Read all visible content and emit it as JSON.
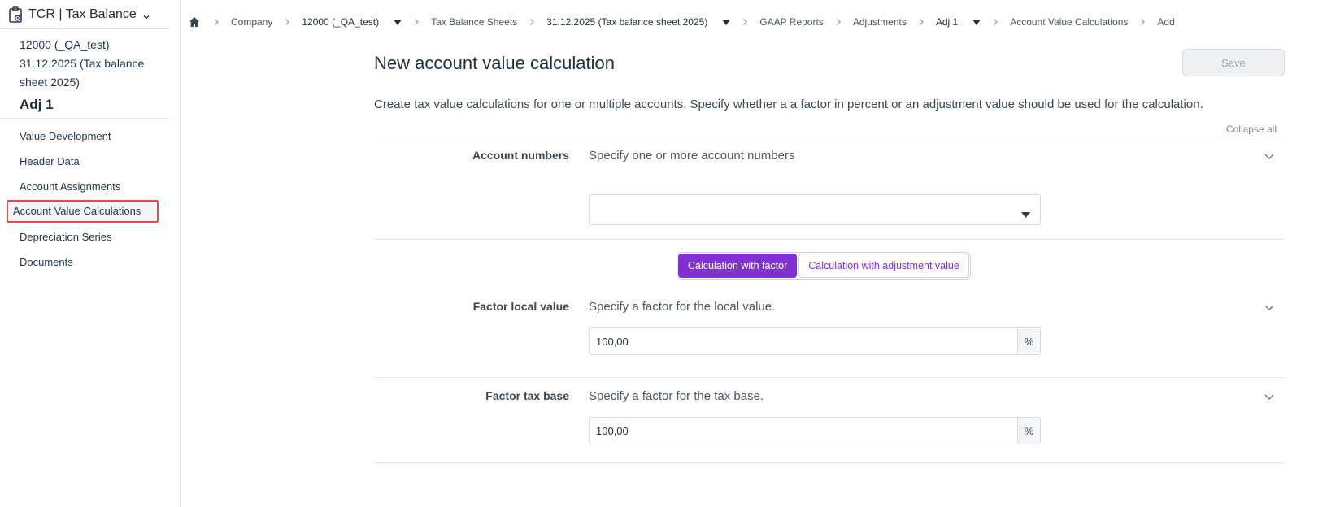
{
  "app": {
    "title": "TCR | Tax Balance"
  },
  "context": {
    "company": "12000 (_QA_test)",
    "balance_sheet": "31.12.2025 (Tax balance sheet 2025)",
    "current": "Adj 1"
  },
  "nav": {
    "items": [
      {
        "label": "Value Development"
      },
      {
        "label": "Header Data"
      },
      {
        "label": "Account Assignments"
      },
      {
        "label": "Account Value Calculations"
      },
      {
        "label": "Depreciation Series"
      },
      {
        "label": "Documents"
      }
    ],
    "active_index": 3
  },
  "breadcrumb": {
    "items": [
      "Company",
      "12000 (_QA_test)",
      "Tax Balance Sheets",
      "31.12.2025 (Tax balance sheet 2025)",
      "GAAP Reports",
      "Adjustments",
      "Adj 1",
      "Account Value Calculations",
      "Add"
    ]
  },
  "page": {
    "title": "New account value calculation",
    "save_label": "Save",
    "description": "Create tax value calculations for one or multiple accounts. Specify whether a a factor in percent or an adjustment value should be used for the calculation.",
    "collapse_all": "Collapse all"
  },
  "account_numbers": {
    "label": "Account numbers",
    "description": "Specify one or more account numbers",
    "value": ""
  },
  "calc_mode": {
    "factor_label": "Calculation with factor",
    "adjustment_label": "Calculation with adjustment value",
    "selected": "factor"
  },
  "factor_local": {
    "label": "Factor local value",
    "description": "Specify a factor for the local value.",
    "value": "100,00",
    "unit": "%"
  },
  "factor_tax": {
    "label": "Factor tax base",
    "description": "Specify a factor for the tax base.",
    "value": "100,00",
    "unit": "%"
  },
  "colors": {
    "accent": "#8131d1",
    "highlight_border": "#e04a4a"
  }
}
